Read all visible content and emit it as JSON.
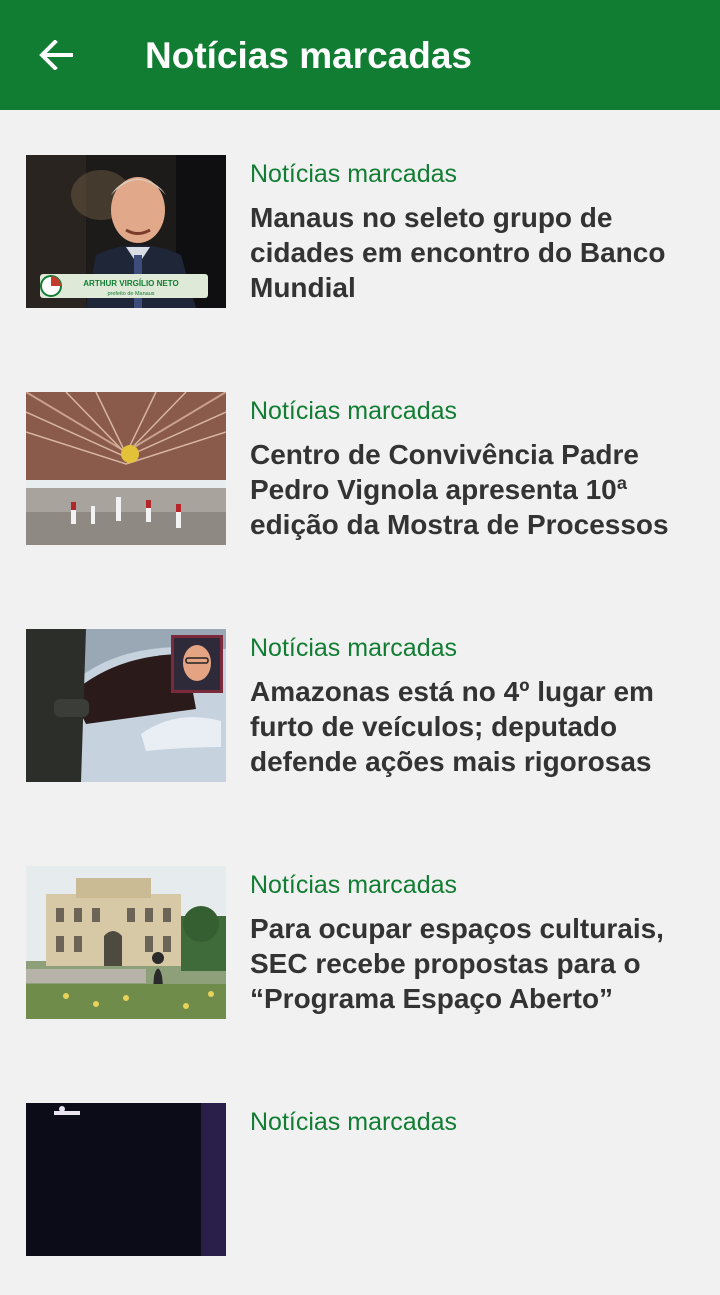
{
  "appbar": {
    "title": "Notícias marcadas",
    "back_icon": "arrow-left-icon",
    "background_color": "#117d33"
  },
  "items": [
    {
      "category": "Notícias marcadas",
      "title": "Manaus no seleto grupo de cidades em encontro do Banco Mundial",
      "thumb_caption_name": "ARTHUR VIRGÍLIO NETO",
      "thumb_caption_role": "prefeito de Manaus"
    },
    {
      "category": "Notícias marcadas",
      "title": "Centro de Convivência Padre Pedro Vignola apresenta 10ª edição da Mostra de Processos"
    },
    {
      "category": "Notícias marcadas",
      "title": "Amazonas está no 4º lugar em furto de veículos; deputado defende ações mais rigorosas"
    },
    {
      "category": "Notícias marcadas",
      "title": "Para ocupar espaços culturais, SEC recebe propostas para o “Programa Espaço Aberto”"
    },
    {
      "category": "Notícias marcadas",
      "title": ""
    }
  ],
  "colors": {
    "accent": "#117d33",
    "headline": "#333333",
    "background": "#f1f1f1"
  }
}
